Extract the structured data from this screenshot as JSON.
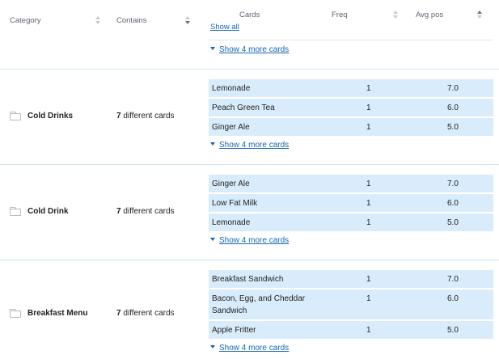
{
  "header": {
    "category": "Category",
    "contains": "Contains",
    "cards": "Cards",
    "show_all": "Show all",
    "freq": "Freq",
    "avg_pos": "Avg pos"
  },
  "top_show_more": "Show 4 more cards",
  "groups": [
    {
      "category": "Cold Drinks",
      "contains_count": "7",
      "contains_suffix": " different cards",
      "cards": [
        {
          "name": "Lemonade",
          "freq": "1",
          "pos": "7.0"
        },
        {
          "name": "Peach Green Tea",
          "freq": "1",
          "pos": "6.0"
        },
        {
          "name": "Ginger Ale",
          "freq": "1",
          "pos": "5.0"
        }
      ],
      "show_more": "Show 4 more cards"
    },
    {
      "category": "Cold Drink",
      "contains_count": "7",
      "contains_suffix": " different cards",
      "cards": [
        {
          "name": "Ginger Ale",
          "freq": "1",
          "pos": "7.0"
        },
        {
          "name": "Low Fat Milk",
          "freq": "1",
          "pos": "6.0"
        },
        {
          "name": "Lemonade",
          "freq": "1",
          "pos": "5.0"
        }
      ],
      "show_more": "Show 4 more cards"
    },
    {
      "category": "Breakfast Menu",
      "contains_count": "7",
      "contains_suffix": " different cards",
      "cards": [
        {
          "name": "Breakfast Sandwich",
          "freq": "1",
          "pos": "7.0"
        },
        {
          "name": "Bacon, Egg, and Cheddar Sandwich",
          "freq": "1",
          "pos": "6.0"
        },
        {
          "name": "Apple Fritter",
          "freq": "1",
          "pos": "5.0"
        }
      ],
      "show_more": "Show 4 more cards"
    }
  ],
  "icons": {
    "folder": "folder-icon",
    "sort": "sort-icon",
    "expand": "caret-down-icon"
  },
  "colors": {
    "card_row_bg": "#d9ecfb",
    "link": "#1466b8",
    "separator": "#cfe6ec"
  }
}
